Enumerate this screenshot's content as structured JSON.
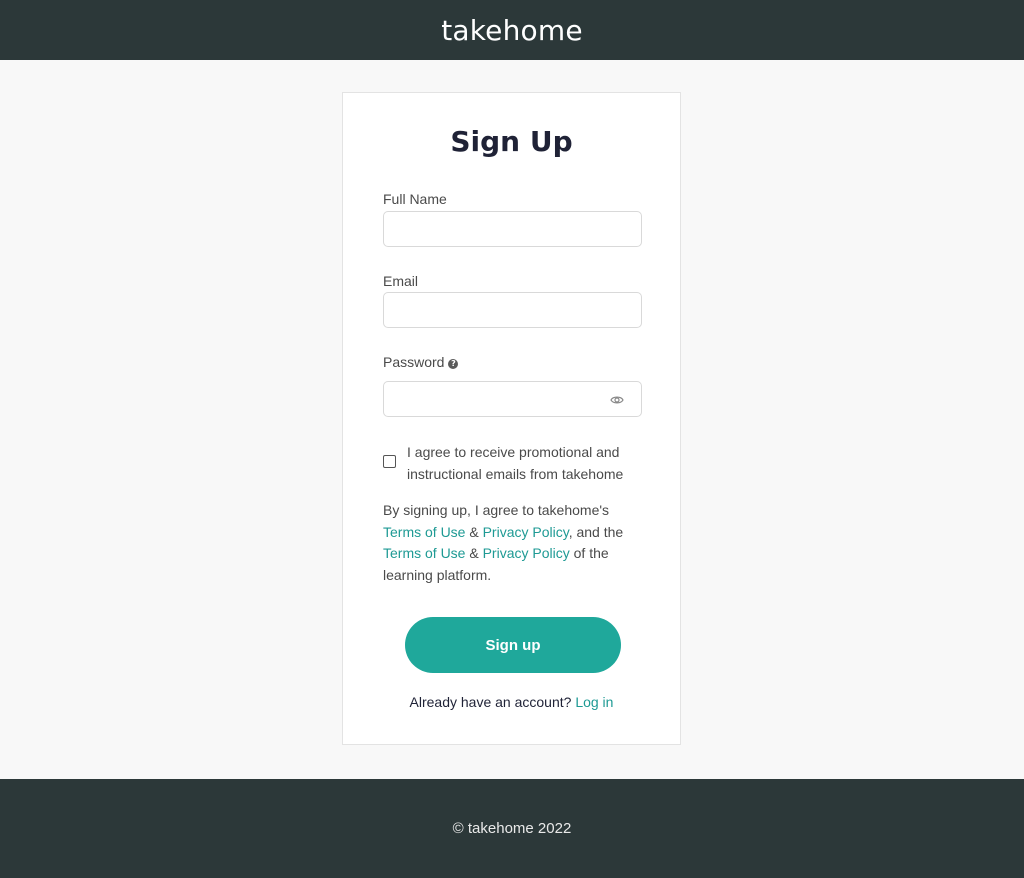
{
  "header": {
    "brand": "takehome"
  },
  "form": {
    "title": "Sign Up",
    "full_name": {
      "label": "Full Name",
      "value": "",
      "placeholder": ""
    },
    "email": {
      "label": "Email",
      "value": "",
      "placeholder": ""
    },
    "password": {
      "label": "Password",
      "value": "",
      "placeholder": "",
      "help_icon": "question-circle-icon",
      "toggle_icon": "eye-icon"
    },
    "promo_checkbox": {
      "checked": false,
      "label": "I agree to receive promotional and instructional emails from takehome"
    },
    "legal": {
      "prefix": "By signing up, I agree to takehome's",
      "terms_1": "Terms of Use",
      "amp_1": "&",
      "privacy_1": "Privacy Policy",
      "middle": ", and the",
      "terms_2": "Terms of Use",
      "amp_2": "&",
      "privacy_2": "Privacy Policy",
      "suffix": "of the learning platform."
    },
    "submit_label": "Sign up",
    "login_prompt": "Already have an account?",
    "login_link": "Log in"
  },
  "footer": {
    "text": "© takehome 2022"
  },
  "colors": {
    "header_bg": "#2c3839",
    "accent": "#1fa89b",
    "link": "#1e9a94",
    "page_bg": "#f8f8f8"
  }
}
